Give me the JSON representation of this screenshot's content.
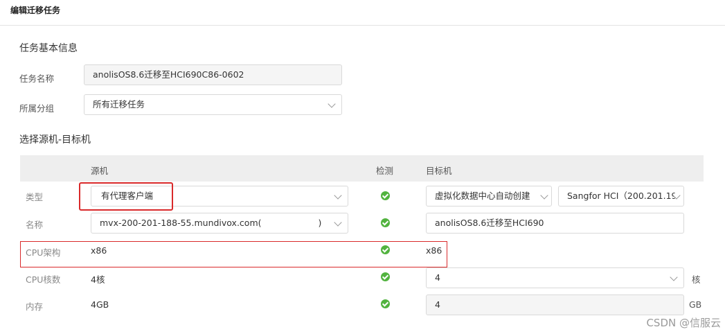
{
  "header": {
    "title": "编辑迁移任务"
  },
  "basic": {
    "section_title": "任务基本信息",
    "task_name_label": "任务名称",
    "task_name_value": "anolisOS8.6迁移至HCI690C86-0602",
    "group_label": "所属分组",
    "group_value": "所有迁移任务"
  },
  "select": {
    "section_title": "选择源机-目标机",
    "columns": {
      "source": "源机",
      "check": "检测",
      "target": "目标机"
    }
  },
  "rows": {
    "type": {
      "label": "类型",
      "source_value": "有代理客户端",
      "target_value": "虚拟化数据中心自动创建",
      "target_platform": "Sangfor HCI（200.201.19"
    },
    "name": {
      "label": "名称",
      "source_value": "mvx-200-201-188-55.mundivox.com(",
      "source_suffix": ")",
      "target_value": "anolisOS8.6迁移至HCI690"
    },
    "cpu_arch": {
      "label": "CPU架构",
      "source_value": "x86",
      "target_value": "x86"
    },
    "cpu_cores": {
      "label": "CPU核数",
      "source_value": "4核",
      "target_value": "4",
      "unit": "核"
    },
    "memory": {
      "label": "内存",
      "source_value": "4GB",
      "target_value": "4",
      "unit": "GB"
    }
  },
  "icons": {
    "check": "check-circle-icon",
    "dropdown": "chevron-down-icon"
  },
  "colors": {
    "check": "#52b33f",
    "highlight": "#d9292a",
    "header_bg": "#eeeeee"
  },
  "watermark": "CSDN @信服云"
}
